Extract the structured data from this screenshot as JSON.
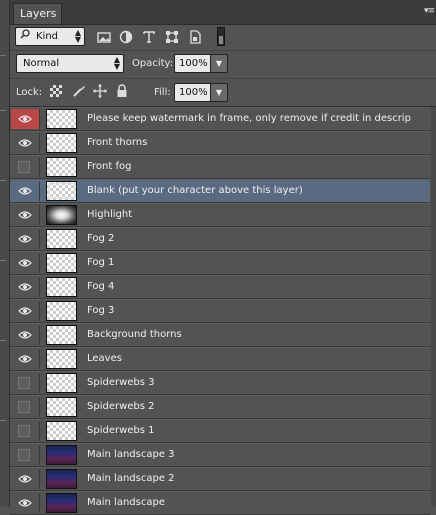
{
  "panel": {
    "tab_label": "Layers",
    "menu_glyph": "▾≡"
  },
  "filter": {
    "kind_label": "Kind",
    "icons": [
      "search-icon",
      "image-filter-icon",
      "adjustment-filter-icon",
      "type-filter-icon",
      "shape-filter-icon",
      "smart-object-filter-icon",
      "filter-toggle-icon"
    ]
  },
  "blend": {
    "mode": "Normal",
    "opacity_label": "Opacity:",
    "opacity_value": "100%"
  },
  "lock": {
    "label": "Lock:",
    "fill_label": "Fill:",
    "fill_value": "100%",
    "icons": [
      "lock-transparency-icon",
      "lock-image-icon",
      "lock-position-icon",
      "lock-all-icon"
    ]
  },
  "colors": {
    "selected_row": "#5a6a80",
    "visibility_highlight": "#b84848",
    "panel_bg": "#535353"
  },
  "layers": [
    {
      "name": "Please keep watermark in frame, only remove if credit in descrip",
      "visible": true,
      "thumb": "checker",
      "highlight": true
    },
    {
      "name": "Front thorns",
      "visible": true,
      "thumb": "checker"
    },
    {
      "name": "Front fog",
      "visible": false,
      "thumb": "checker"
    },
    {
      "name": "Blank (put your character above this layer)",
      "visible": true,
      "thumb": "checker",
      "selected": true
    },
    {
      "name": "Highlight",
      "visible": true,
      "thumb": "glow"
    },
    {
      "name": "Fog 2",
      "visible": true,
      "thumb": "checker"
    },
    {
      "name": "Fog 1",
      "visible": true,
      "thumb": "checker"
    },
    {
      "name": "Fog 4",
      "visible": true,
      "thumb": "checker"
    },
    {
      "name": "Fog 3",
      "visible": true,
      "thumb": "checker"
    },
    {
      "name": "Background thorns",
      "visible": true,
      "thumb": "checker"
    },
    {
      "name": "Leaves",
      "visible": true,
      "thumb": "checker"
    },
    {
      "name": "Spiderwebs 3",
      "visible": false,
      "thumb": "checker"
    },
    {
      "name": "Spiderwebs 2",
      "visible": false,
      "thumb": "checker"
    },
    {
      "name": "Spiderwebs 1",
      "visible": false,
      "thumb": "checker"
    },
    {
      "name": "Main landscape 3",
      "visible": false,
      "thumb": "land"
    },
    {
      "name": "Main landscape 2",
      "visible": true,
      "thumb": "land"
    },
    {
      "name": "Main landscape",
      "visible": true,
      "thumb": "land"
    }
  ]
}
